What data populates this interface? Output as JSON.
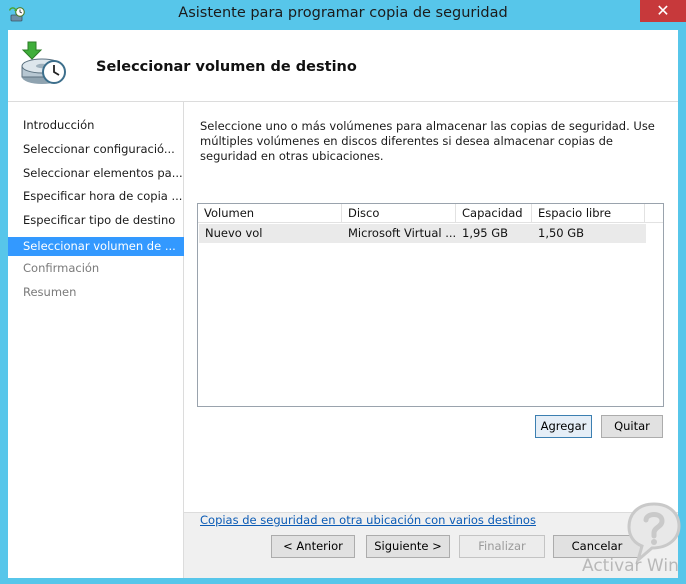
{
  "window": {
    "title": "Asistente para programar copia de seguridad",
    "close_label": "✕"
  },
  "header": {
    "title": "Seleccionar volumen de destino",
    "icon": "backup-wizard-icon"
  },
  "nav": {
    "items": [
      {
        "label": "Introducción",
        "state": "normal"
      },
      {
        "label": "Seleccionar configuració...",
        "state": "normal"
      },
      {
        "label": "Seleccionar elementos pa...",
        "state": "normal"
      },
      {
        "label": "Especificar hora de copia ...",
        "state": "normal"
      },
      {
        "label": "Especificar tipo de destino",
        "state": "normal"
      },
      {
        "label": "Seleccionar volumen de ...",
        "state": "active"
      },
      {
        "label": "Confirmación",
        "state": "disabled"
      },
      {
        "label": "Resumen",
        "state": "disabled"
      }
    ]
  },
  "main": {
    "description": "Seleccione uno o más volúmenes para almacenar las copias de seguridad. Use múltiples volúmenes en discos diferentes si desea almacenar copias de seguridad en otras ubicaciones.",
    "table": {
      "columns": [
        "Volumen",
        "Disco",
        "Capacidad",
        "Espacio libre"
      ],
      "rows": [
        [
          "Nuevo vol",
          "Microsoft Virtual ...",
          "1,95 GB",
          "1,50 GB"
        ]
      ]
    },
    "add_label": "Agregar",
    "remove_label": "Quitar",
    "link_label": "Copias de seguridad en otra ubicación con varios destinos"
  },
  "footer": {
    "back_label": "< Anterior",
    "next_label": "Siguiente >",
    "finish_label": "Finalizar",
    "cancel_label": "Cancelar"
  },
  "overlay": {
    "watermark": "Activar Win",
    "help_icon": "help-question-icon"
  },
  "colors": {
    "titlebar": "#57c6ea",
    "close": "#c7393b",
    "selection": "#3399ff",
    "link": "#0b5bb5"
  }
}
